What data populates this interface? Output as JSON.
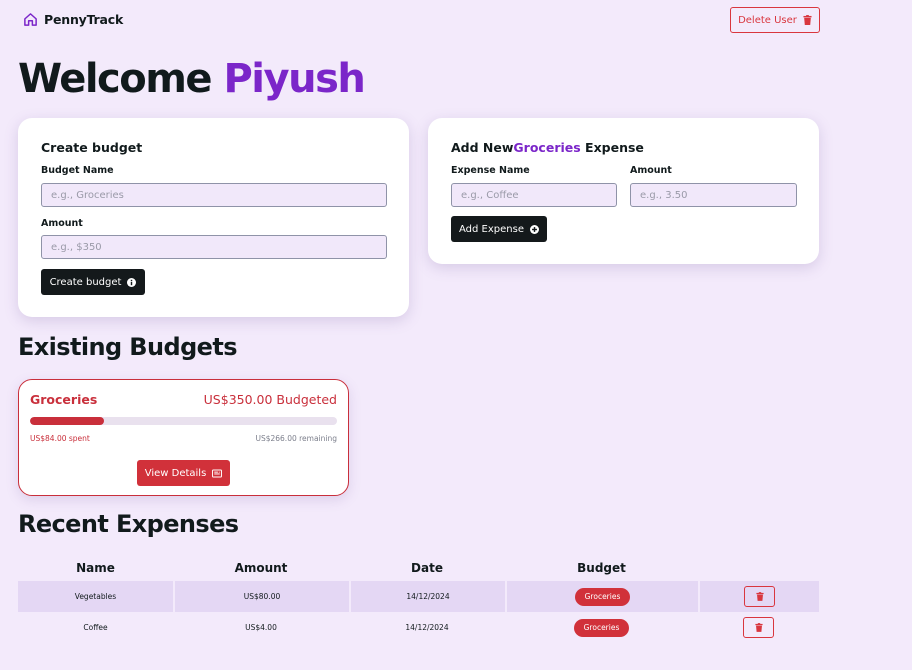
{
  "header": {
    "brand_name": "PennyTrack",
    "delete_user_label": "Delete User"
  },
  "welcome": {
    "prefix": "Welcome",
    "username": "Piyush"
  },
  "create_budget": {
    "title": "Create budget",
    "name_label": "Budget Name",
    "name_placeholder": "e.g., Groceries",
    "amount_label": "Amount",
    "amount_placeholder": "e.g., $350",
    "submit_label": "Create budget"
  },
  "add_expense": {
    "title_prefix": "Add New",
    "budget_name": "Groceries",
    "title_suffix": " Expense",
    "name_label": "Expense Name",
    "name_placeholder": "e.g., Coffee",
    "amount_label": "Amount",
    "amount_placeholder": "e.g., 3.50",
    "submit_label": "Add Expense"
  },
  "existing_budgets": {
    "heading": "Existing Budgets",
    "items": [
      {
        "name": "Groceries",
        "budgeted": "US$350.00 Budgeted",
        "spent": "US$84.00 spent",
        "remaining": "US$266.00 remaining",
        "progress_fraction": 0.24,
        "view_label": "View Details"
      }
    ]
  },
  "recent_expenses": {
    "heading": "Recent Expenses",
    "columns": [
      "Name",
      "Amount",
      "Date",
      "Budget"
    ],
    "rows": [
      {
        "name": "Vegetables",
        "amount": "US$80.00",
        "date": "14/12/2024",
        "budget": "Groceries"
      },
      {
        "name": "Coffee",
        "amount": "US$4.00",
        "date": "14/12/2024",
        "budget": "Groceries"
      }
    ]
  },
  "colors": {
    "accent_purple": "#7b26c9",
    "danger_red": "#d1313a",
    "dark_button": "#14191b",
    "page_background": "#f3eafb"
  },
  "icons": {
    "brand": "home-icon",
    "delete": "trash-icon",
    "create": "plus-circle-icon",
    "view": "banknote-icon"
  }
}
